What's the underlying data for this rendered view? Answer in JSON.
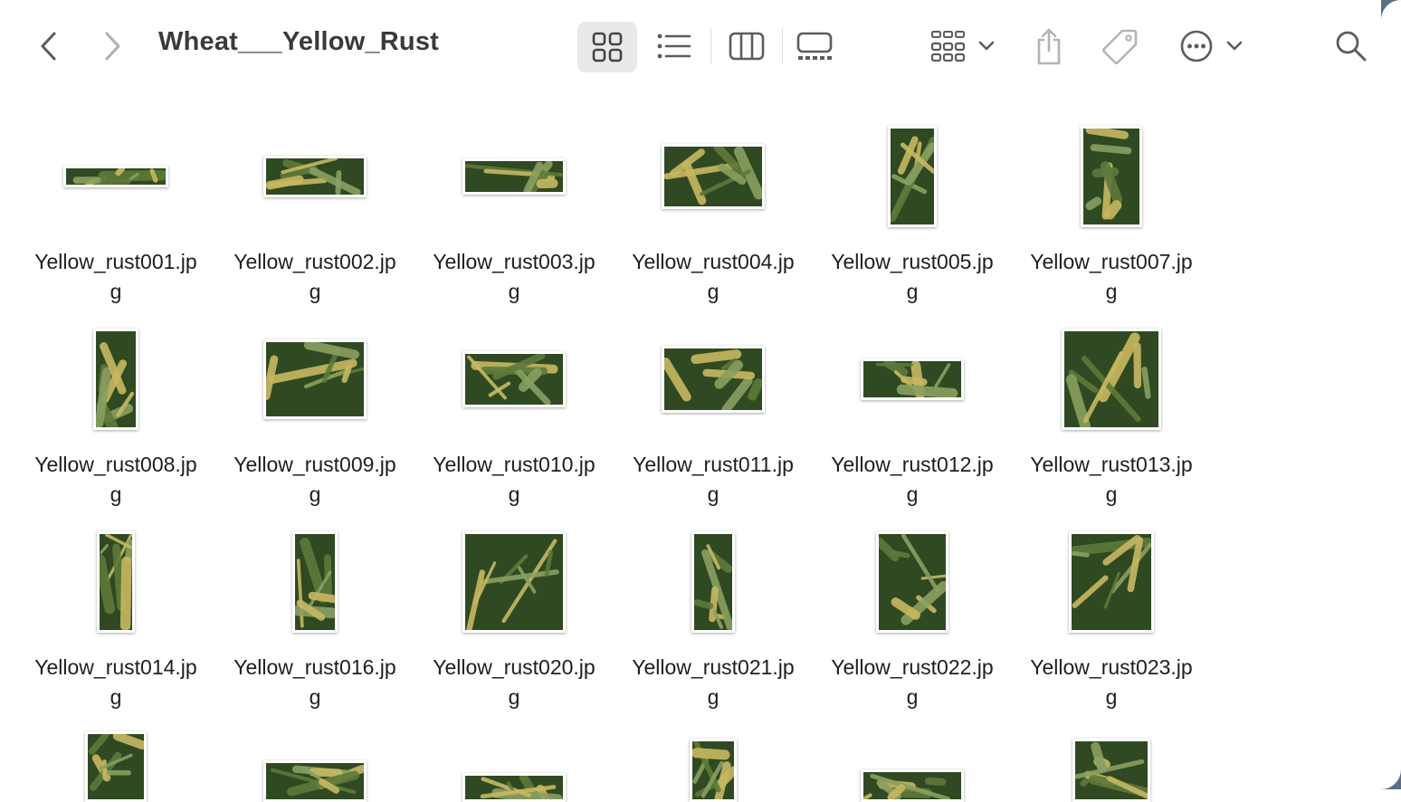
{
  "window": {
    "title": "Wheat___Yellow_Rust"
  },
  "toolbar": {
    "back_icon": "chevron-left-icon",
    "forward_icon": "chevron-right-icon",
    "view_icons": [
      "icon-view-grid-icon",
      "list-view-icon",
      "column-view-icon",
      "gallery-view-icon"
    ],
    "active_view": "icon-view",
    "group_icon": "group-by-icon",
    "share_icon": "share-icon",
    "tag_icon": "tag-icon",
    "more_icon": "ellipsis-circle-icon",
    "search_icon": "search-icon"
  },
  "colors": {
    "leaf_dark": "#2f4a22",
    "leaf_mid": "#5d7a3a",
    "leaf_yellow": "#c9b860",
    "selection_bg": "#e9e9ea",
    "icon_gray": "#5c5c5c"
  },
  "files": [
    {
      "name_line1": "Yellow_rust001.jp",
      "name_line2": "g"
    },
    {
      "name_line1": "Yellow_rust002.jp",
      "name_line2": "g"
    },
    {
      "name_line1": "Yellow_rust003.jp",
      "name_line2": "g"
    },
    {
      "name_line1": "Yellow_rust004.jp",
      "name_line2": "g"
    },
    {
      "name_line1": "Yellow_rust005.jp",
      "name_line2": "g"
    },
    {
      "name_line1": "Yellow_rust007.jp",
      "name_line2": "g"
    },
    {
      "name_line1": "Yellow_rust008.jp",
      "name_line2": "g"
    },
    {
      "name_line1": "Yellow_rust009.jp",
      "name_line2": "g"
    },
    {
      "name_line1": "Yellow_rust010.jp",
      "name_line2": "g"
    },
    {
      "name_line1": "Yellow_rust011.jp",
      "name_line2": "g"
    },
    {
      "name_line1": "Yellow_rust012.jp",
      "name_line2": "g"
    },
    {
      "name_line1": "Yellow_rust013.jp",
      "name_line2": "g"
    },
    {
      "name_line1": "Yellow_rust014.jp",
      "name_line2": "g"
    },
    {
      "name_line1": "Yellow_rust016.jp",
      "name_line2": "g"
    },
    {
      "name_line1": "Yellow_rust020.jp",
      "name_line2": "g"
    },
    {
      "name_line1": "Yellow_rust021.jp",
      "name_line2": "g"
    },
    {
      "name_line1": "Yellow_rust022.jp",
      "name_line2": "g"
    },
    {
      "name_line1": "Yellow_rust023.jp",
      "name_line2": "g"
    }
  ]
}
